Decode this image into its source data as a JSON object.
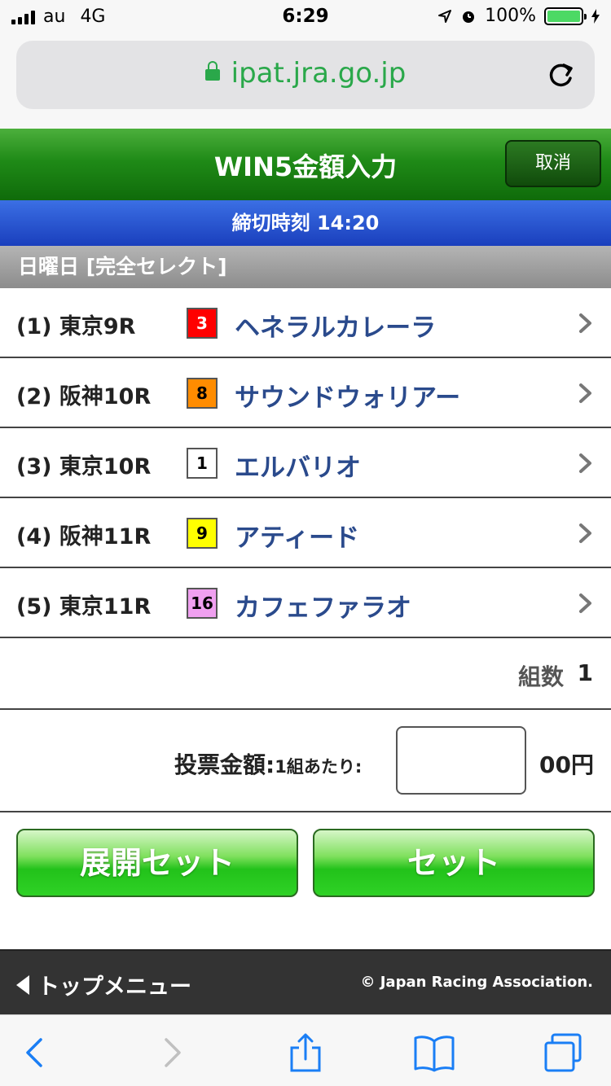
{
  "status_bar": {
    "carrier": "au",
    "network": "4G",
    "time": "6:29",
    "battery": "100%"
  },
  "browser": {
    "url": "ipat.jra.go.jp"
  },
  "header": {
    "title": "WIN5金額入力",
    "cancel_label": "取消"
  },
  "deadline": {
    "text": "締切時刻 14:20"
  },
  "section": {
    "title": "日曜日 [完全セレクト]"
  },
  "races": [
    {
      "label": "(1) 東京9R",
      "number": "3",
      "horse": "ヘネラルカレーラ",
      "color": "#ff0000",
      "text_color": "#ffffff"
    },
    {
      "label": "(2) 阪神10R",
      "number": "8",
      "horse": "サウンドウォリアー",
      "color": "#ff8c00",
      "text_color": "#000000"
    },
    {
      "label": "(3) 東京10R",
      "number": "1",
      "horse": "エルバリオ",
      "color": "#ffffff",
      "text_color": "#000000"
    },
    {
      "label": "(4) 阪神11R",
      "number": "9",
      "horse": "アティード",
      "color": "#ffff00",
      "text_color": "#000000"
    },
    {
      "label": "(5) 東京11R",
      "number": "16",
      "horse": "カフェファラオ",
      "color": "#f0a0f0",
      "text_color": "#000000"
    }
  ],
  "count": {
    "label": "組数",
    "value": "1"
  },
  "amount": {
    "label": "投票金額:",
    "sub_label": "1組あたり:",
    "value": "",
    "unit": "00円"
  },
  "buttons": {
    "expand_set": "展開セット",
    "set": "セット"
  },
  "footer": {
    "top_menu": "トップメニュー",
    "copyright": "© Japan Racing Association."
  },
  "toolbar": {
    "icons": [
      "back-icon",
      "forward-icon",
      "share-icon",
      "bookmarks-icon",
      "tabs-icon"
    ]
  }
}
